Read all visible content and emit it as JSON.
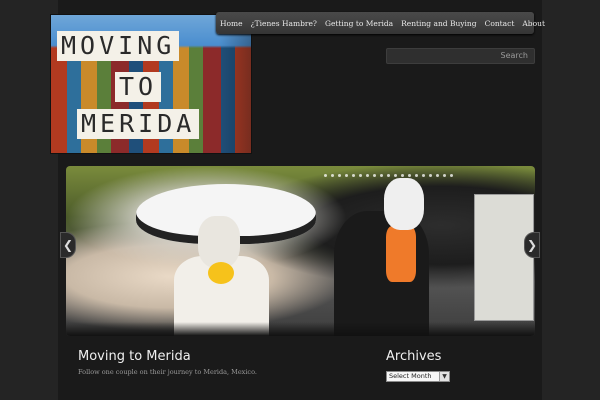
{
  "logo": {
    "words": [
      "MOVING",
      "TO",
      "MERIDA"
    ]
  },
  "nav": {
    "items": [
      {
        "label": "Home"
      },
      {
        "label": "¿Tienes Hambre?"
      },
      {
        "label": "Getting to Merida"
      },
      {
        "label": "Renting and Buying"
      },
      {
        "label": "Contact"
      },
      {
        "label": "About"
      }
    ]
  },
  "search": {
    "placeholder": "Search"
  },
  "slider": {
    "prev_glyph": "❮",
    "next_glyph": "❯",
    "pager_dot_count": 19
  },
  "site": {
    "title": "Moving to Merida",
    "tagline": "Follow one couple on their journey to Merida, Mexico."
  },
  "archives": {
    "title": "Archives",
    "selected": "Select Month"
  }
}
